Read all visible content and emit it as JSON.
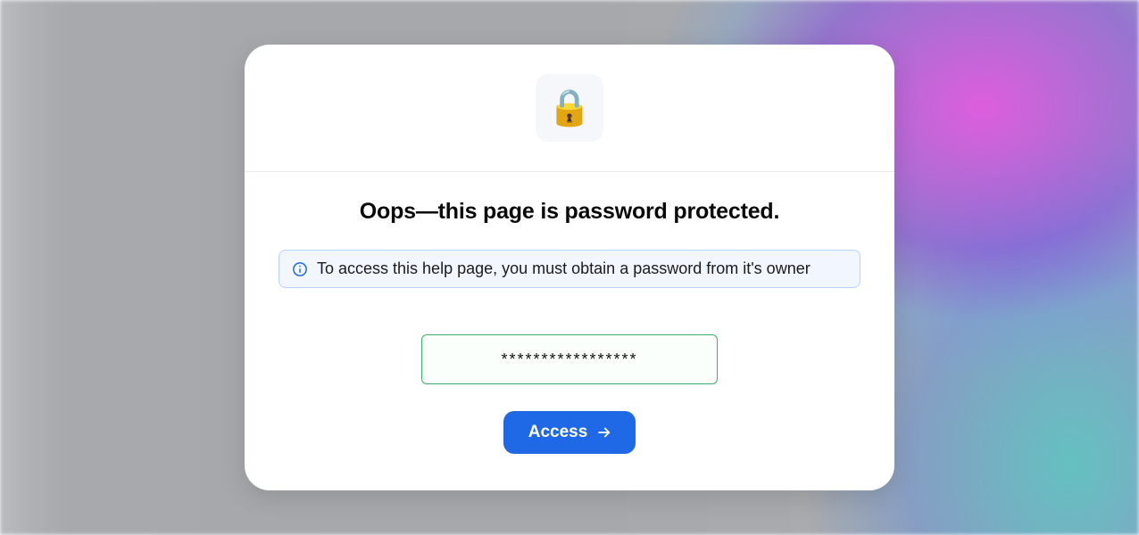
{
  "header": {
    "lock_emoji": "🔒"
  },
  "title": {
    "prefix": "Oops—this page is ",
    "bold": "password protected."
  },
  "info": {
    "text": "To access this help page, you must obtain a password from it's owner"
  },
  "form": {
    "password_value": "*****************",
    "access_label": "Access"
  },
  "colors": {
    "accent": "#1f68e6",
    "info_border": "#b9d3ff",
    "info_bg": "#f1f6ff",
    "input_border": "#38b26b"
  }
}
